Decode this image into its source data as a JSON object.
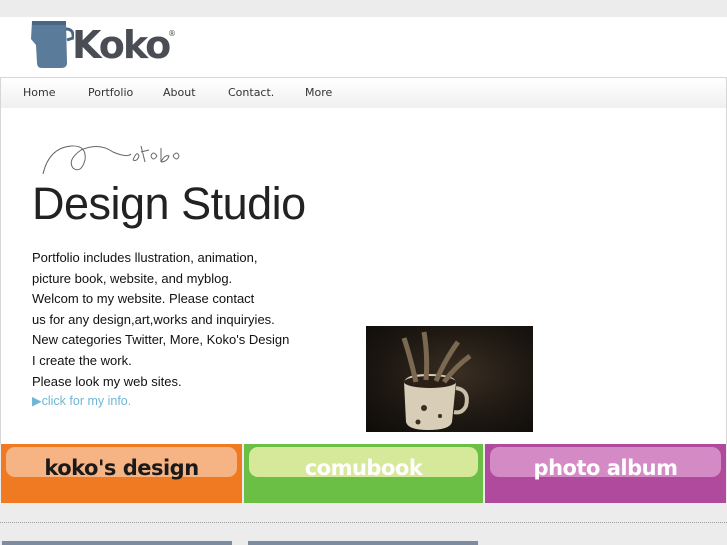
{
  "header": {
    "logo_text": "Koko",
    "logo_reg": "®"
  },
  "nav": {
    "items": [
      "Home",
      "Portfolio",
      "About",
      "Contact.",
      "More"
    ]
  },
  "hero": {
    "title": "Design Studio",
    "description_lines": [
      "Portfolio includes llustration, animation,",
      "picture book, website, and myblog.",
      "Welcom to my website. Please contact",
      "us for any design,art,works and inquiryies.",
      "New categories Twitter, More, Koko's Design",
      "I create the work.",
      "Please look my web sites."
    ],
    "info_link": "▶click for my info."
  },
  "banners": [
    {
      "label": "koko's design",
      "color": "#ef7a22",
      "pill": "#f6b484",
      "text_color": "#1a1a1a"
    },
    {
      "label": "comubook",
      "color": "#6cbf45",
      "pill": "#d6e89a",
      "text_color": "#ffffff"
    },
    {
      "label": "photo album",
      "color": "#b04a9c",
      "pill": "#d48ac4",
      "text_color": "#ffffff"
    }
  ],
  "colors": {
    "logo": "#4a4e54",
    "link": "#6fb6d6",
    "mug_icon": "#5b7b9a"
  }
}
